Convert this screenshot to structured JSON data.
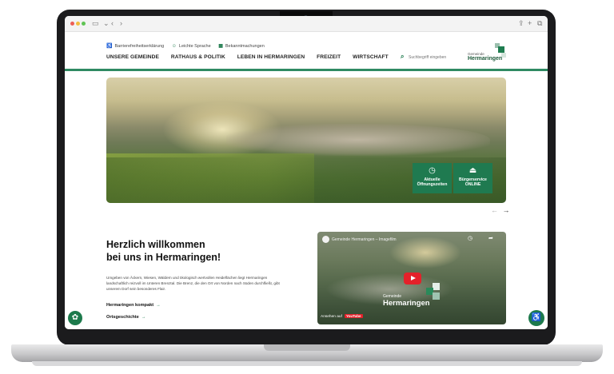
{
  "utility": {
    "accessibility": "Barrierefreiheitserklärung",
    "easy_language": "Leichte Sprache",
    "announcements": "Bekanntmachungen"
  },
  "nav": [
    "UNSERE GEMEINDE",
    "RATHAUS & POLITIK",
    "LEBEN IN HERMARINGEN",
    "FREIZEIT",
    "WIRTSCHAFT"
  ],
  "search": {
    "placeholder": "Suchbegriff eingeben"
  },
  "logo": {
    "small": "Gemeinde",
    "big": "Hermaringen"
  },
  "hero": {
    "tile1": "Aktuelle Öffnungszeiten",
    "tile2": "Bürgerservice ONLINE"
  },
  "intro": {
    "headline_line1": "Herzlich willkommen",
    "headline_line2": "bei uns in Hermaringen!",
    "text": "Umgeben von Äckern, Wiesen, Wäldern und ökologisch wertvollen Heideflächen liegt Hermaringen landschaftlich reizvoll im Unteren Brenztal. Die Brenz, die den Ort von Norden nach Süden durchfließt, gibt unserem Dorf sein besonderes Flair.",
    "link1": "Hermaringen kompakt",
    "link2": "Ortsgeschichte"
  },
  "video": {
    "title": "Gemeinde Hermaringen – Imagefilm",
    "logo_small": "Gemeinde",
    "logo_big": "Hermaringen",
    "watch_on": "Ansehen auf",
    "youtube": "YouTube"
  },
  "colors": {
    "brand_green": "#1d7a4c",
    "youtube_red": "#e4212a"
  }
}
